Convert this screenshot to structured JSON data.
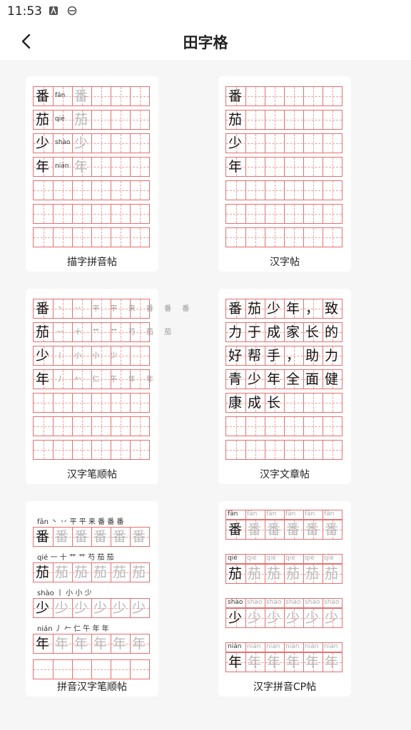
{
  "status_bar": {
    "time": "11:53"
  },
  "header": {
    "title": "田字格"
  },
  "cards": [
    {
      "label": "描字拼音帖"
    },
    {
      "label": "汉字帖"
    },
    {
      "label": "汉字笔顺帖"
    },
    {
      "label": "汉字文章帖"
    },
    {
      "label": "拼音汉字笔顺帖"
    },
    {
      "label": "汉字拼音CP帖"
    }
  ],
  "samples": {
    "chars": [
      "番",
      "茄",
      "少",
      "年"
    ],
    "pinyin": [
      "fān",
      "qié",
      "shào",
      "nián"
    ],
    "article_rows": [
      [
        "番",
        "茄",
        "少",
        "年",
        "，",
        "致"
      ],
      [
        "力",
        "于",
        "成",
        "家",
        "长",
        "的"
      ],
      [
        "好",
        "帮",
        "手",
        "，",
        "助",
        "力"
      ],
      [
        "青",
        "少",
        "年",
        "全",
        "面",
        "健"
      ],
      [
        "康",
        "成",
        "长",
        "",
        "",
        ""
      ]
    ],
    "stroke_rows": [
      "丶 丷 平 平 来 番 番 番",
      "一 十 艹 艹 芍 茄 茄",
      "丨 小 小 少",
      "丿 𠂉 仁 午 年 年"
    ]
  },
  "colors": {
    "grid": "#e57070",
    "grid_dashed": "#f0a0a0",
    "background": "#f6f6f6",
    "card": "#ffffff"
  }
}
